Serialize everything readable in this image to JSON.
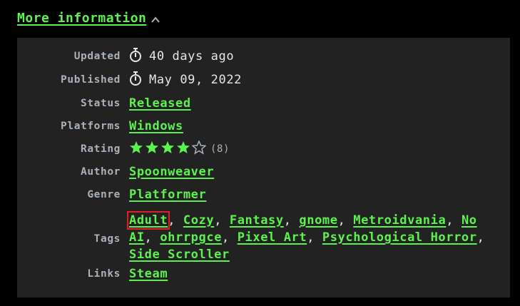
{
  "toggle": {
    "label": "More information",
    "icon": "chevron-up-icon"
  },
  "rows": {
    "updated": {
      "label": "Updated",
      "value": "40 days ago",
      "icon": "stopwatch-icon"
    },
    "published": {
      "label": "Published",
      "value": "May 09, 2022",
      "icon": "stopwatch-icon"
    },
    "status": {
      "label": "Status",
      "value": "Released"
    },
    "platforms": {
      "label": "Platforms",
      "value": "Windows"
    },
    "rating": {
      "label": "Rating",
      "stars_filled": 4,
      "stars_total": 5,
      "count": "(8)"
    },
    "author": {
      "label": "Author",
      "value": "Spoonweaver"
    },
    "genre": {
      "label": "Genre",
      "value": "Platformer"
    },
    "tags": {
      "label": "Tags",
      "items": [
        "Adult",
        "Cozy",
        "Fantasy",
        "gnome",
        "Metroidvania",
        "No AI",
        "ohrrpgce",
        "Pixel Art",
        "Psychological Horror",
        "Side Scroller"
      ],
      "separator": ","
    },
    "links": {
      "label": "Links",
      "value": "Steam"
    }
  },
  "colors": {
    "background": "#000000",
    "panel": "#222222",
    "link": "#5df24f",
    "label": "#aab2bc",
    "text": "#e6e6e6",
    "highlight": "#e02020"
  }
}
